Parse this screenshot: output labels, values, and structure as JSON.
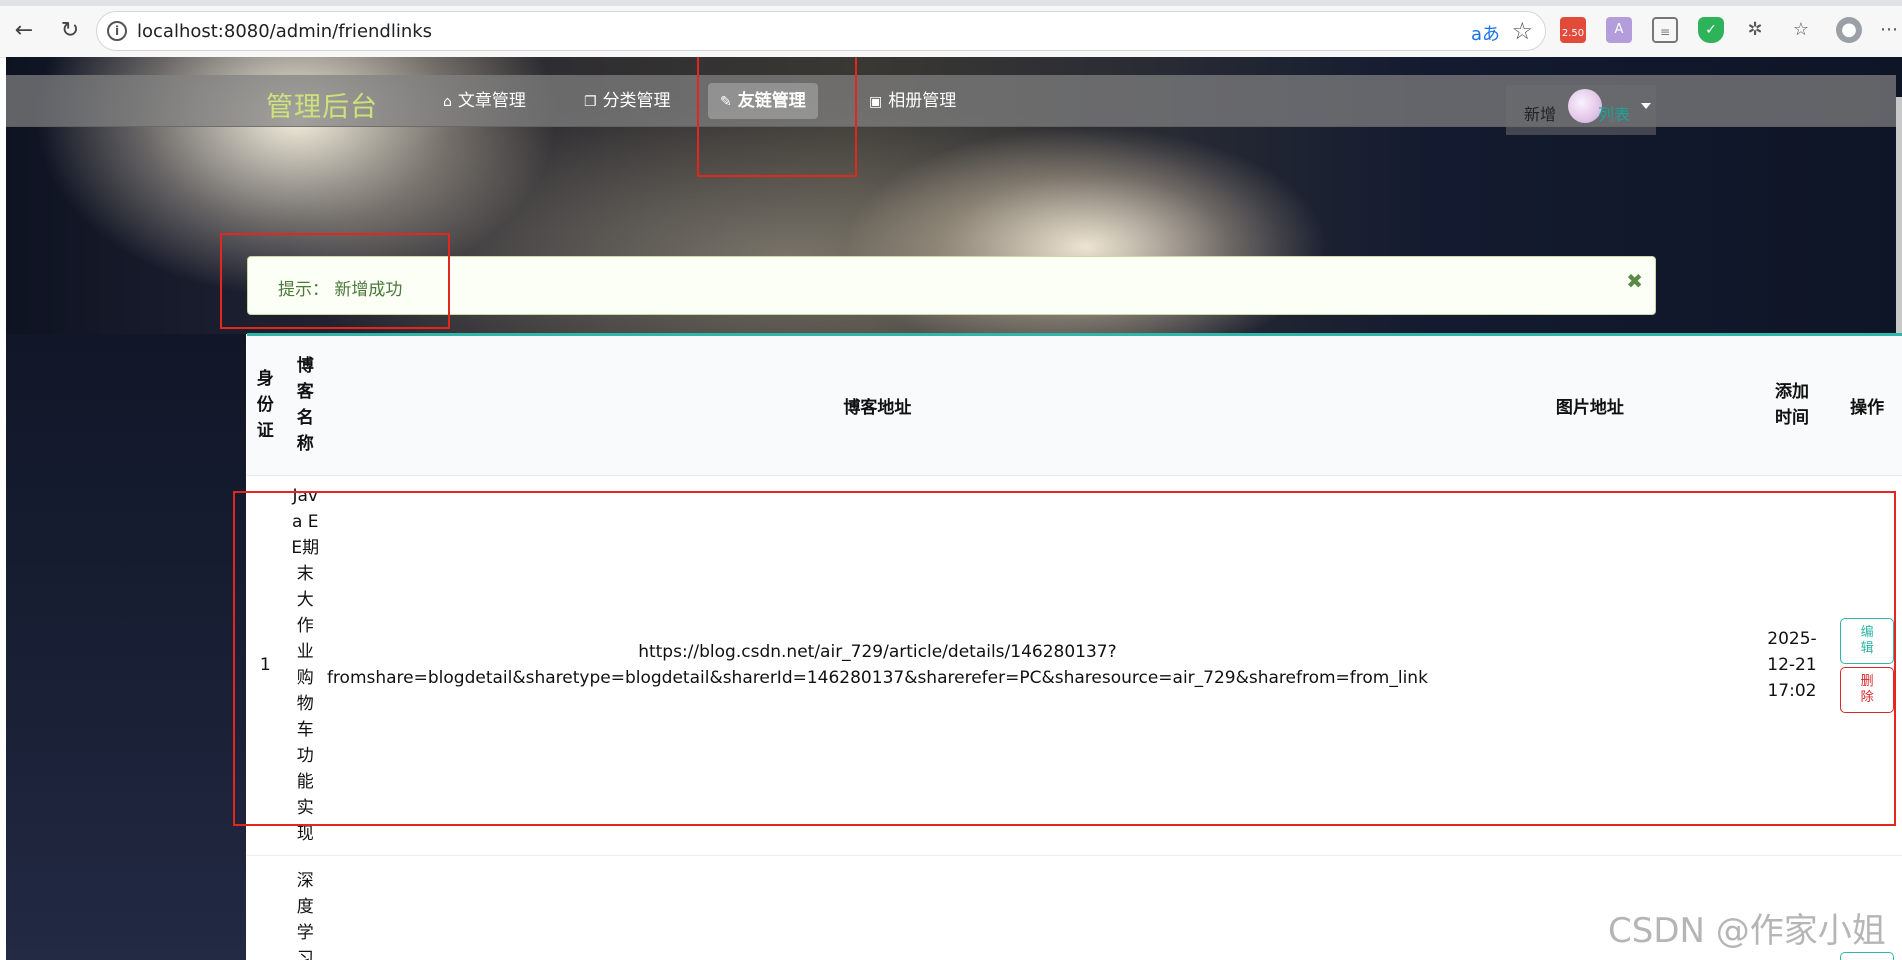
{
  "browser": {
    "url": "localhost:8080/admin/friendlinks",
    "badge": "2.50"
  },
  "navbar": {
    "brand": "管理后台",
    "items": [
      {
        "icon": "home-icon",
        "label": "文章管理"
      },
      {
        "icon": "copy-icon",
        "label": "分类管理"
      },
      {
        "icon": "pencil-icon",
        "label": "友链管理"
      },
      {
        "icon": "image-icon",
        "label": "相册管理"
      }
    ],
    "right": {
      "new": "新增",
      "list": "列表"
    }
  },
  "alert": {
    "text": "提示：  新增成功",
    "close": "✖"
  },
  "table": {
    "headers": [
      "身份证",
      "博客名称",
      "博客地址",
      "图片地址",
      "添加时间",
      "操作"
    ],
    "rows": [
      {
        "id": "1",
        "name": "Java EE期末大作业购物车功能实现",
        "url_line1": "https://blog.csdn.net/air_729/article/details/146280137?",
        "url_line2": "fromshare=blogdetail&sharetype=blogdetail&sharerId=146280137&sharerefer=PC&sharesource=air_729&sharefrom=from_link",
        "image": "",
        "time": "2025-12-21 17:02",
        "edit": "编辑",
        "delete": "删除"
      },
      {
        "id": "",
        "name": "深度学习"
      }
    ]
  },
  "watermark": "CSDN @作家小姐"
}
